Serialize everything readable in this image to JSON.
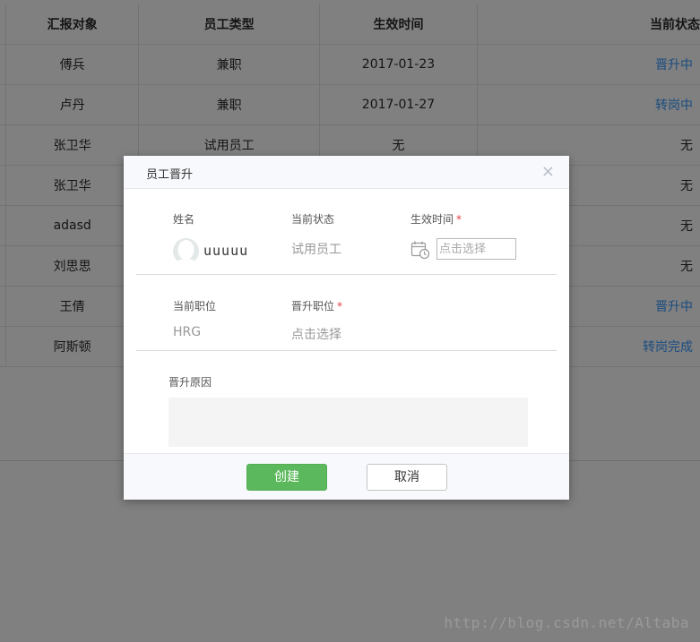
{
  "table": {
    "headers": [
      "",
      "汇报对象",
      "员工类型",
      "生效时间",
      "当前状态"
    ],
    "rows": [
      {
        "report_to": "傅兵",
        "type": "兼职",
        "date": "2017-01-23",
        "status": "晋升中",
        "status_link": true
      },
      {
        "report_to": "卢丹",
        "type": "兼职",
        "date": "2017-01-27",
        "status": "转岗中",
        "status_link": true
      },
      {
        "report_to": "张卫华",
        "type": "试用员工",
        "date": "无",
        "status": "无",
        "status_link": false
      },
      {
        "report_to": "张卫华",
        "type": "",
        "date": "",
        "status": "无",
        "status_link": false
      },
      {
        "report_to": "adasd",
        "type": "",
        "date": "",
        "status": "无",
        "status_link": false
      },
      {
        "report_to": "刘思思",
        "type": "",
        "date": "",
        "status": "无",
        "status_link": false
      },
      {
        "report_to": "王倩",
        "type": "",
        "date": "",
        "status": "晋升中",
        "status_link": true
      },
      {
        "report_to": "阿斯顿",
        "type": "",
        "date": "",
        "status": "转岗完成",
        "status_link": true
      }
    ]
  },
  "modal": {
    "title": "员工晋升",
    "close_icon": "×",
    "name_label": "姓名",
    "name_value": "uuuuu",
    "current_status_label": "当前状态",
    "current_status_value": "试用员工",
    "effective_time_label": "生效时间",
    "required_mark": "*",
    "effective_time_placeholder": "点击选择",
    "current_position_label": "当前职位",
    "current_position_value": "HRG",
    "promote_position_label": "晋升职位",
    "promote_position_placeholder": "点击选择",
    "reason_label": "晋升原因",
    "create_button": "创建",
    "cancel_button": "取消"
  },
  "watermark": "http://blog.csdn.net/Altaba",
  "colors": {
    "overlay_bg": "#808080",
    "link_blue": "#1a4c80",
    "create_green": "#5cb85c",
    "required_red": "#e04040"
  }
}
